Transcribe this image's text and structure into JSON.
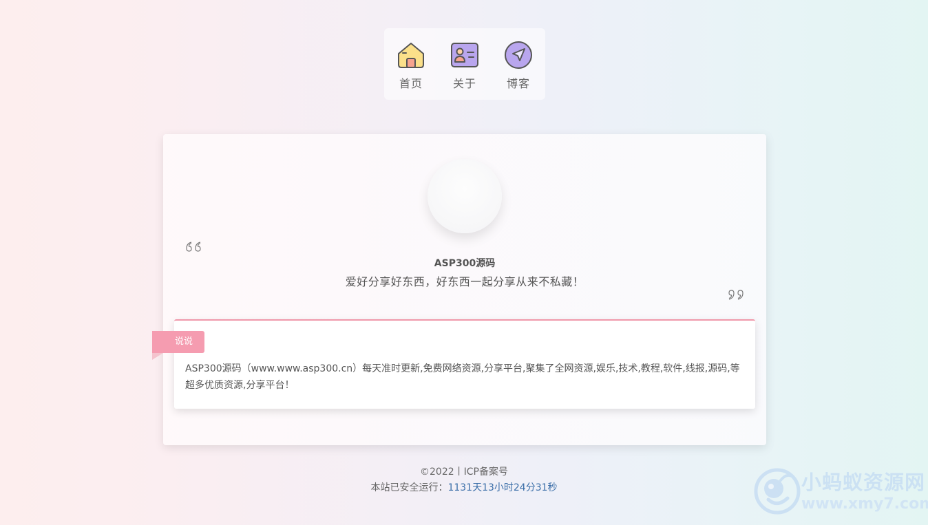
{
  "nav": {
    "items": [
      {
        "label": "首页",
        "icon": "home-icon"
      },
      {
        "label": "关于",
        "icon": "id-card-icon"
      },
      {
        "label": "博客",
        "icon": "navigate-icon"
      }
    ]
  },
  "profile": {
    "name": "ASP300源码",
    "motto": "爱好分享好东西，好东西一起分享从来不私藏！"
  },
  "talk": {
    "tag": "说说",
    "text": "ASP300源码（www.www.asp300.cn）每天准时更新,免费网络资源,分享平台,聚集了全网资源,娱乐,技术,教程,软件,线报,源码,等超多优质资源,分享平台！"
  },
  "footer": {
    "copyright": "©2022丨ICP备案号",
    "run_prefix": "本站已安全运行：",
    "run_time": "1131天13小时24分31秒"
  },
  "watermark": {
    "title": "小蚂蚁资源网",
    "url": "www.xmy7.com"
  },
  "colors": {
    "accent_pink": "#f59cb0",
    "run_time_blue": "#3a6ea8"
  }
}
